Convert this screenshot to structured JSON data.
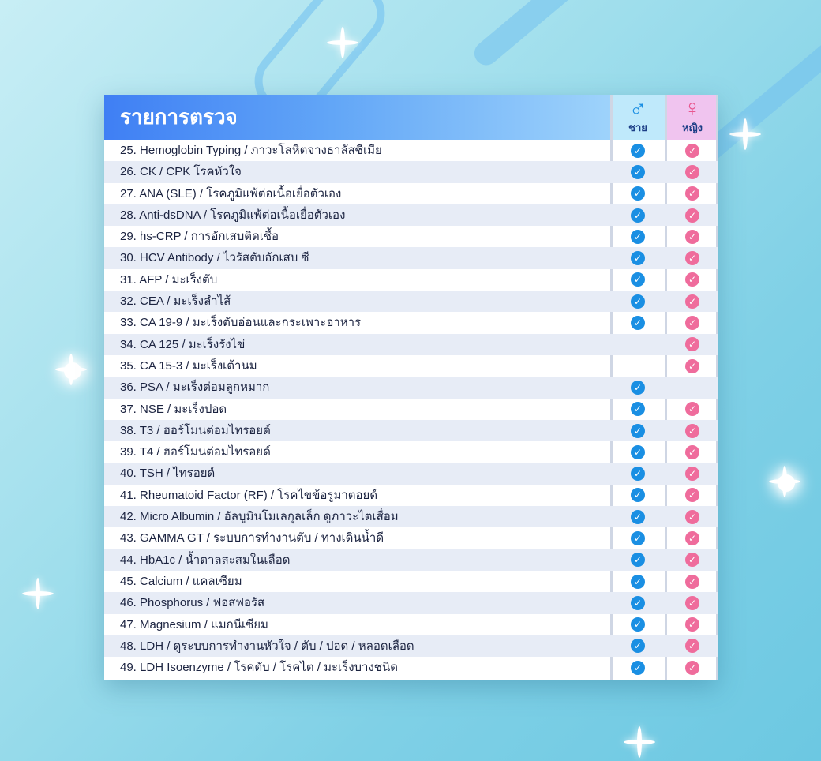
{
  "header": {
    "title": "รายการตรวจ",
    "male_label": "ชาย",
    "female_label": "หญิง",
    "male_symbol": "♂",
    "female_symbol": "♀"
  },
  "colors": {
    "male_check": "#1a8fe3",
    "female_check": "#ef6c9c",
    "header_gradient_start": "#3f7ff4",
    "header_gradient_end": "#9ed3fb"
  },
  "check_glyph": "✓",
  "items": [
    {
      "label": "25. Hemoglobin Typing / ภาวะโลหิตจางธาลัสซีเมีย",
      "male": true,
      "female": true
    },
    {
      "label": "26. CK / CPK โรคหัวใจ",
      "male": true,
      "female": true
    },
    {
      "label": "27. ANA (SLE) / โรคภูมิแพ้ต่อเนื้อเยื่อตัวเอง",
      "male": true,
      "female": true
    },
    {
      "label": "28. Anti-dsDNA / โรคภูมิแพ้ต่อเนื้อเยื่อตัวเอง",
      "male": true,
      "female": true
    },
    {
      "label": "29. hs-CRP / การอักเสบติดเชื้อ",
      "male": true,
      "female": true
    },
    {
      "label": "30. HCV Antibody / ไวรัสตับอักเสบ ซี",
      "male": true,
      "female": true
    },
    {
      "label": "31. AFP / มะเร็งตับ",
      "male": true,
      "female": true
    },
    {
      "label": "32. CEA / มะเร็งลำไส้",
      "male": true,
      "female": true
    },
    {
      "label": "33. CA 19-9 / มะเร็งตับอ่อนและกระเพาะอาหาร",
      "male": true,
      "female": true
    },
    {
      "label": "34. CA 125 / มะเร็งรังไข่",
      "male": false,
      "female": true
    },
    {
      "label": "35. CA 15-3 / มะเร็งเต้านม",
      "male": false,
      "female": true
    },
    {
      "label": "36. PSA / มะเร็งต่อมลูกหมาก",
      "male": true,
      "female": false
    },
    {
      "label": "37. NSE / มะเร็งปอด",
      "male": true,
      "female": true
    },
    {
      "label": "38. T3 / ฮอร์โมนต่อมไทรอยด์",
      "male": true,
      "female": true
    },
    {
      "label": "39. T4 / ฮอร์โมนต่อมไทรอยด์",
      "male": true,
      "female": true
    },
    {
      "label": "40. TSH / ไทรอยด์",
      "male": true,
      "female": true
    },
    {
      "label": "41. Rheumatoid Factor (RF) / โรคไขข้อรูมาตอยด์",
      "male": true,
      "female": true
    },
    {
      "label": "42. Micro Albumin / อัลบูมินโมเลกุลเล็ก ดูภาวะไตเสื่อม",
      "male": true,
      "female": true
    },
    {
      "label": "43. GAMMA GT / ระบบการทำงานตับ / ทางเดินน้ำดี",
      "male": true,
      "female": true
    },
    {
      "label": "44. HbA1c / น้ำตาลสะสมในเลือด",
      "male": true,
      "female": true
    },
    {
      "label": "45. Calcium / แคลเซียม",
      "male": true,
      "female": true
    },
    {
      "label": "46. Phosphorus / ฟอสฟอรัส",
      "male": true,
      "female": true
    },
    {
      "label": "47. Magnesium / แมกนีเซียม",
      "male": true,
      "female": true
    },
    {
      "label": "48. LDH / ดูระบบการทำงานหัวใจ / ตับ / ปอด / หลอดเลือด",
      "male": true,
      "female": true
    },
    {
      "label": "49. LDH Isoenzyme / โรคตับ / โรคไต / มะเร็งบางชนิด",
      "male": true,
      "female": true
    }
  ]
}
